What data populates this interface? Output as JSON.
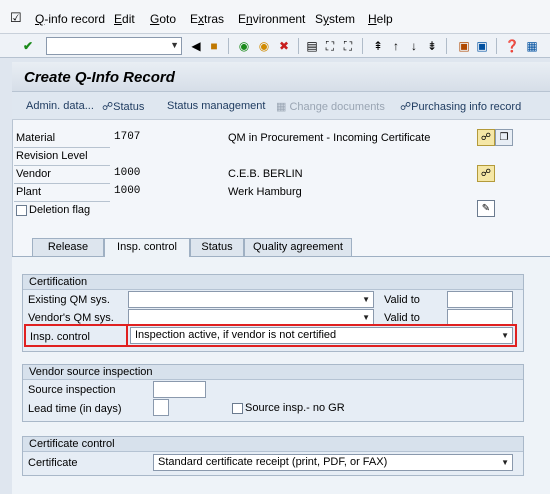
{
  "menu": {
    "items": [
      "Q-info record",
      "Edit",
      "Goto",
      "Extras",
      "Environment",
      "System",
      "Help"
    ],
    "accelerators": [
      "Q",
      "E",
      "G",
      "x",
      "n",
      "y",
      "H"
    ]
  },
  "title": "Create Q-Info Record",
  "app_toolbar": {
    "admin_data": "Admin. data...",
    "status": "Status",
    "status_management": "Status management",
    "change_documents": "Change documents",
    "purchasing_info_record": "Purchasing info record"
  },
  "header": {
    "material_label": "Material",
    "material_value": "1707",
    "material_desc": "QM in Procurement - Incoming Certificate",
    "revision_label": "Revision Level",
    "vendor_label": "Vendor",
    "vendor_value": "1000",
    "vendor_name": "C.E.B. BERLIN",
    "plant_label": "Plant",
    "plant_value": "1000",
    "plant_name": "Werk Hamburg",
    "deletion_flag": "Deletion flag"
  },
  "tabs": [
    "Release",
    "Insp. control",
    "Status",
    "Quality agreement"
  ],
  "certification": {
    "title": "Certification",
    "existing_qm_label": "Existing QM sys.",
    "existing_qm_value": "",
    "vendor_qm_label": "Vendor's QM sys.",
    "vendor_qm_value": "",
    "valid_to_label": "Valid to",
    "insp_control_label": "Insp. control",
    "insp_control_value": "Inspection active, if vendor is not certified"
  },
  "vendor_source": {
    "title": "Vendor source inspection",
    "source_label": "Source inspection",
    "source_value": "",
    "lead_time_label": "Lead time (in days)",
    "lead_time_value": "",
    "no_gr_label": "Source insp.- no GR"
  },
  "certificate_control": {
    "title": "Certificate control",
    "certificate_label": "Certificate",
    "certificate_value": "Standard certificate receipt (print, PDF, or FAX)"
  },
  "colors": {
    "highlight": "#e02020",
    "title_bar": "#d6dee8",
    "background": "#dfe6ef"
  }
}
